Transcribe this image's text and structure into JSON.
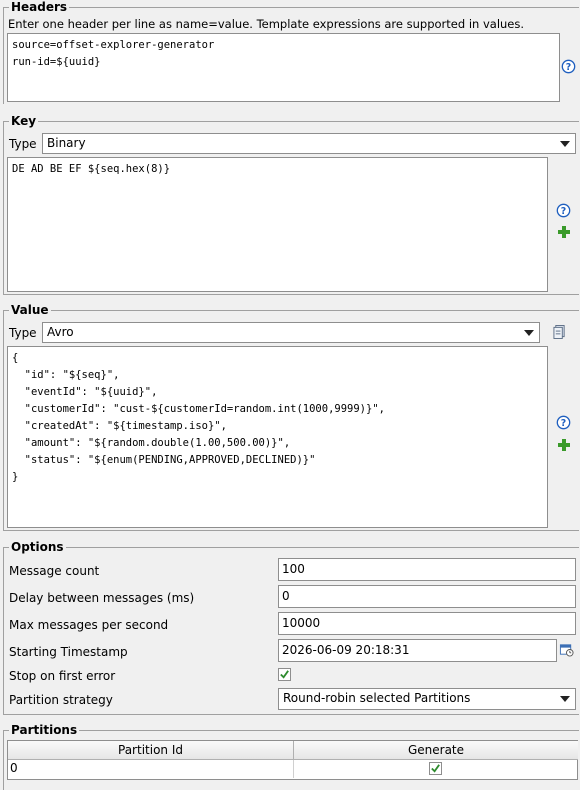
{
  "headers": {
    "title": "Headers",
    "hint": "Enter one header per line as name=value. Template expressions are supported in values.",
    "text": "source=offset-explorer-generator\nrun-id=${uuid}"
  },
  "key": {
    "title": "Key",
    "type_label": "Type",
    "type_value": "Binary",
    "text": "DE AD BE EF ${seq.hex(8)}"
  },
  "value": {
    "title": "Value",
    "type_label": "Type",
    "type_value": "Avro",
    "text": "{\n  \"id\": \"${seq}\",\n  \"eventId\": \"${uuid}\",\n  \"customerId\": \"cust-${customerId=random.int(1000,9999)}\",\n  \"createdAt\": \"${timestamp.iso}\",\n  \"amount\": \"${random.double(1.00,500.00)}\",\n  \"status\": \"${enum(PENDING,APPROVED,DECLINED)}\"\n}"
  },
  "options": {
    "title": "Options",
    "message_count_label": "Message count",
    "message_count": "100",
    "delay_label": "Delay between messages (ms)",
    "delay": "0",
    "max_per_sec_label": "Max messages per second",
    "max_per_sec": "10000",
    "start_ts_label": "Starting Timestamp",
    "start_ts": "2026-06-09 20:18:31",
    "stop_on_error_label": "Stop on first error",
    "stop_on_error": true,
    "partition_strategy_label": "Partition strategy",
    "partition_strategy": "Round-robin selected Partitions"
  },
  "partitions": {
    "title": "Partitions",
    "columns": [
      "Partition Id",
      "Generate"
    ],
    "rows": [
      {
        "id": "0",
        "generate": true
      }
    ]
  },
  "colors": {
    "help_blue": "#1f5fbf",
    "plus_green": "#3a9a2a",
    "check_green": "#2e8b2e"
  }
}
